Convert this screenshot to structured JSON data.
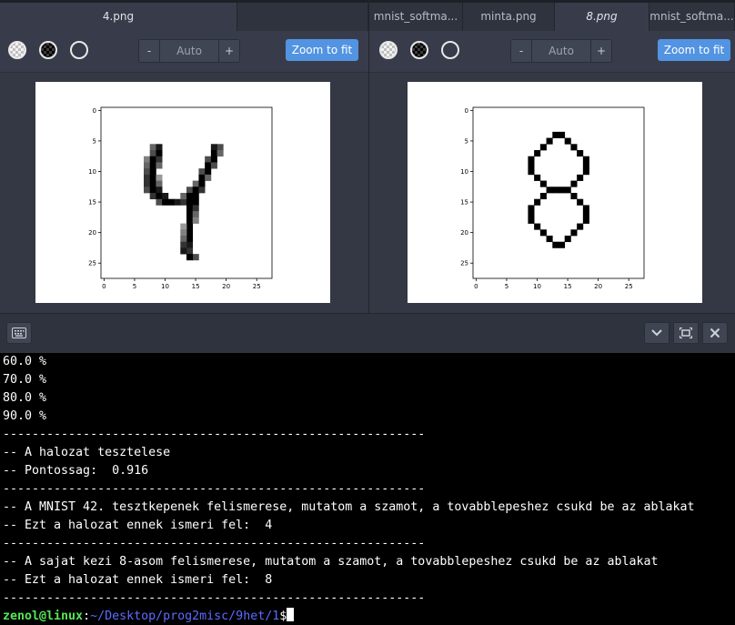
{
  "left_pane": {
    "tabs": [
      {
        "label": "4.png",
        "active": true
      },
      {
        "label": "",
        "active": false
      }
    ],
    "zoom": {
      "minus": "-",
      "value": "Auto",
      "plus": "+"
    },
    "fit_label": "Zoom to fit"
  },
  "right_pane": {
    "tabs": [
      {
        "label": "mnist_softma...",
        "active": false
      },
      {
        "label": "minta.png",
        "active": false
      },
      {
        "label": "8.png",
        "active": true
      },
      {
        "label": "mnist_softma...",
        "active": false
      }
    ],
    "zoom": {
      "minus": "-",
      "value": "Auto",
      "plus": "+"
    },
    "fit_label": "Zoom to fit"
  },
  "plots": {
    "ytick_labels": [
      "0",
      "5",
      "10",
      "15",
      "20",
      "25"
    ],
    "xtick_labels": [
      "0",
      "5",
      "10",
      "15",
      "20",
      "25"
    ]
  },
  "chart_data": [
    {
      "type": "heatmap",
      "image": "handwritten digit 4 (MNIST sample 42)",
      "shape": [
        28,
        28
      ],
      "xlim": [
        0,
        27
      ],
      "ylim": [
        27,
        0
      ],
      "xticks": [
        0,
        5,
        10,
        15,
        20,
        25
      ],
      "yticks": [
        0,
        5,
        10,
        15,
        20,
        25
      ],
      "colormap": "gray_r"
    },
    {
      "type": "heatmap",
      "image": "hand-drawn digit 8",
      "shape": [
        28,
        28
      ],
      "xlim": [
        0,
        27
      ],
      "ylim": [
        27,
        0
      ],
      "xticks": [
        0,
        5,
        10,
        15,
        20,
        25
      ],
      "yticks": [
        0,
        5,
        10,
        15,
        20,
        25
      ],
      "colormap": "gray_r"
    }
  ],
  "terminal": {
    "lines": [
      "60.0 %",
      "70.0 %",
      "80.0 %",
      "90.0 %",
      "----------------------------------------------------------",
      "-- A halozat tesztelese",
      "-- Pontossag:  0.916",
      "----------------------------------------------------------",
      "-- A MNIST 42. tesztkepenek felismerese, mutatom a szamot, a tovabblepeshez csukd be az ablakat",
      "-- Ezt a halozat ennek ismeri fel:  4",
      "----------------------------------------------------------",
      "-- A sajat kezi 8-asom felismerese, mutatom a szamot, a tovabblepeshez csukd be az ablakat",
      "-- Ezt a halozat ennek ismeri fel:  8",
      "----------------------------------------------------------"
    ],
    "prompt_user": "zenol@linux",
    "prompt_sep": ":",
    "prompt_path": "~/Desktop/prog2misc/9het/1",
    "prompt_symbol": "$"
  },
  "icons": {
    "keyboard": "keyboard-icon",
    "collapse": "chevron-down-icon",
    "maximize": "maximize-icon",
    "close": "close-icon"
  },
  "colors": {
    "accent": "#5294e2",
    "prompt_user": "#55e655",
    "prompt_path": "#5c6cff"
  }
}
